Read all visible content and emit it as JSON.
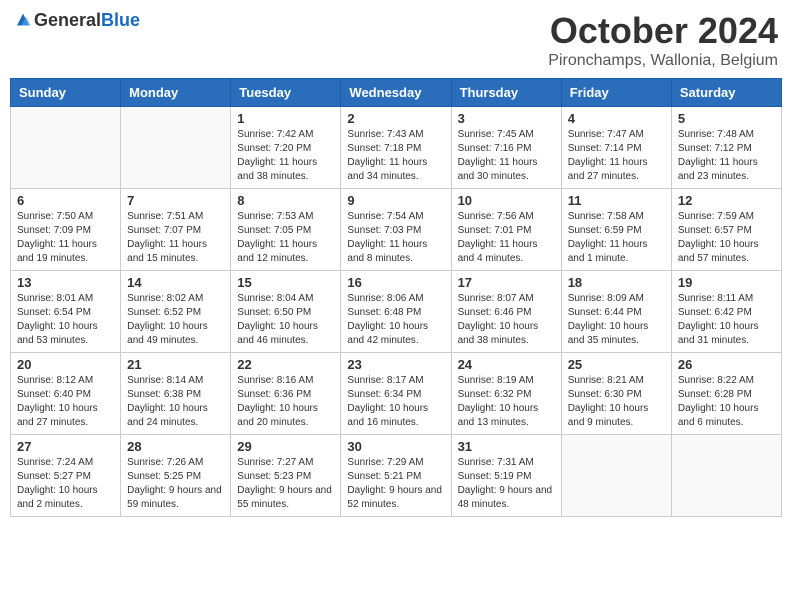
{
  "header": {
    "logo_general": "General",
    "logo_blue": "Blue",
    "month_year": "October 2024",
    "location": "Pironchamps, Wallonia, Belgium"
  },
  "weekdays": [
    "Sunday",
    "Monday",
    "Tuesday",
    "Wednesday",
    "Thursday",
    "Friday",
    "Saturday"
  ],
  "weeks": [
    [
      {
        "day": "",
        "sunrise": "",
        "sunset": "",
        "daylight": ""
      },
      {
        "day": "",
        "sunrise": "",
        "sunset": "",
        "daylight": ""
      },
      {
        "day": "1",
        "sunrise": "Sunrise: 7:42 AM",
        "sunset": "Sunset: 7:20 PM",
        "daylight": "Daylight: 11 hours and 38 minutes."
      },
      {
        "day": "2",
        "sunrise": "Sunrise: 7:43 AM",
        "sunset": "Sunset: 7:18 PM",
        "daylight": "Daylight: 11 hours and 34 minutes."
      },
      {
        "day": "3",
        "sunrise": "Sunrise: 7:45 AM",
        "sunset": "Sunset: 7:16 PM",
        "daylight": "Daylight: 11 hours and 30 minutes."
      },
      {
        "day": "4",
        "sunrise": "Sunrise: 7:47 AM",
        "sunset": "Sunset: 7:14 PM",
        "daylight": "Daylight: 11 hours and 27 minutes."
      },
      {
        "day": "5",
        "sunrise": "Sunrise: 7:48 AM",
        "sunset": "Sunset: 7:12 PM",
        "daylight": "Daylight: 11 hours and 23 minutes."
      }
    ],
    [
      {
        "day": "6",
        "sunrise": "Sunrise: 7:50 AM",
        "sunset": "Sunset: 7:09 PM",
        "daylight": "Daylight: 11 hours and 19 minutes."
      },
      {
        "day": "7",
        "sunrise": "Sunrise: 7:51 AM",
        "sunset": "Sunset: 7:07 PM",
        "daylight": "Daylight: 11 hours and 15 minutes."
      },
      {
        "day": "8",
        "sunrise": "Sunrise: 7:53 AM",
        "sunset": "Sunset: 7:05 PM",
        "daylight": "Daylight: 11 hours and 12 minutes."
      },
      {
        "day": "9",
        "sunrise": "Sunrise: 7:54 AM",
        "sunset": "Sunset: 7:03 PM",
        "daylight": "Daylight: 11 hours and 8 minutes."
      },
      {
        "day": "10",
        "sunrise": "Sunrise: 7:56 AM",
        "sunset": "Sunset: 7:01 PM",
        "daylight": "Daylight: 11 hours and 4 minutes."
      },
      {
        "day": "11",
        "sunrise": "Sunrise: 7:58 AM",
        "sunset": "Sunset: 6:59 PM",
        "daylight": "Daylight: 11 hours and 1 minute."
      },
      {
        "day": "12",
        "sunrise": "Sunrise: 7:59 AM",
        "sunset": "Sunset: 6:57 PM",
        "daylight": "Daylight: 10 hours and 57 minutes."
      }
    ],
    [
      {
        "day": "13",
        "sunrise": "Sunrise: 8:01 AM",
        "sunset": "Sunset: 6:54 PM",
        "daylight": "Daylight: 10 hours and 53 minutes."
      },
      {
        "day": "14",
        "sunrise": "Sunrise: 8:02 AM",
        "sunset": "Sunset: 6:52 PM",
        "daylight": "Daylight: 10 hours and 49 minutes."
      },
      {
        "day": "15",
        "sunrise": "Sunrise: 8:04 AM",
        "sunset": "Sunset: 6:50 PM",
        "daylight": "Daylight: 10 hours and 46 minutes."
      },
      {
        "day": "16",
        "sunrise": "Sunrise: 8:06 AM",
        "sunset": "Sunset: 6:48 PM",
        "daylight": "Daylight: 10 hours and 42 minutes."
      },
      {
        "day": "17",
        "sunrise": "Sunrise: 8:07 AM",
        "sunset": "Sunset: 6:46 PM",
        "daylight": "Daylight: 10 hours and 38 minutes."
      },
      {
        "day": "18",
        "sunrise": "Sunrise: 8:09 AM",
        "sunset": "Sunset: 6:44 PM",
        "daylight": "Daylight: 10 hours and 35 minutes."
      },
      {
        "day": "19",
        "sunrise": "Sunrise: 8:11 AM",
        "sunset": "Sunset: 6:42 PM",
        "daylight": "Daylight: 10 hours and 31 minutes."
      }
    ],
    [
      {
        "day": "20",
        "sunrise": "Sunrise: 8:12 AM",
        "sunset": "Sunset: 6:40 PM",
        "daylight": "Daylight: 10 hours and 27 minutes."
      },
      {
        "day": "21",
        "sunrise": "Sunrise: 8:14 AM",
        "sunset": "Sunset: 6:38 PM",
        "daylight": "Daylight: 10 hours and 24 minutes."
      },
      {
        "day": "22",
        "sunrise": "Sunrise: 8:16 AM",
        "sunset": "Sunset: 6:36 PM",
        "daylight": "Daylight: 10 hours and 20 minutes."
      },
      {
        "day": "23",
        "sunrise": "Sunrise: 8:17 AM",
        "sunset": "Sunset: 6:34 PM",
        "daylight": "Daylight: 10 hours and 16 minutes."
      },
      {
        "day": "24",
        "sunrise": "Sunrise: 8:19 AM",
        "sunset": "Sunset: 6:32 PM",
        "daylight": "Daylight: 10 hours and 13 minutes."
      },
      {
        "day": "25",
        "sunrise": "Sunrise: 8:21 AM",
        "sunset": "Sunset: 6:30 PM",
        "daylight": "Daylight: 10 hours and 9 minutes."
      },
      {
        "day": "26",
        "sunrise": "Sunrise: 8:22 AM",
        "sunset": "Sunset: 6:28 PM",
        "daylight": "Daylight: 10 hours and 6 minutes."
      }
    ],
    [
      {
        "day": "27",
        "sunrise": "Sunrise: 7:24 AM",
        "sunset": "Sunset: 5:27 PM",
        "daylight": "Daylight: 10 hours and 2 minutes."
      },
      {
        "day": "28",
        "sunrise": "Sunrise: 7:26 AM",
        "sunset": "Sunset: 5:25 PM",
        "daylight": "Daylight: 9 hours and 59 minutes."
      },
      {
        "day": "29",
        "sunrise": "Sunrise: 7:27 AM",
        "sunset": "Sunset: 5:23 PM",
        "daylight": "Daylight: 9 hours and 55 minutes."
      },
      {
        "day": "30",
        "sunrise": "Sunrise: 7:29 AM",
        "sunset": "Sunset: 5:21 PM",
        "daylight": "Daylight: 9 hours and 52 minutes."
      },
      {
        "day": "31",
        "sunrise": "Sunrise: 7:31 AM",
        "sunset": "Sunset: 5:19 PM",
        "daylight": "Daylight: 9 hours and 48 minutes."
      },
      {
        "day": "",
        "sunrise": "",
        "sunset": "",
        "daylight": ""
      },
      {
        "day": "",
        "sunrise": "",
        "sunset": "",
        "daylight": ""
      }
    ]
  ]
}
